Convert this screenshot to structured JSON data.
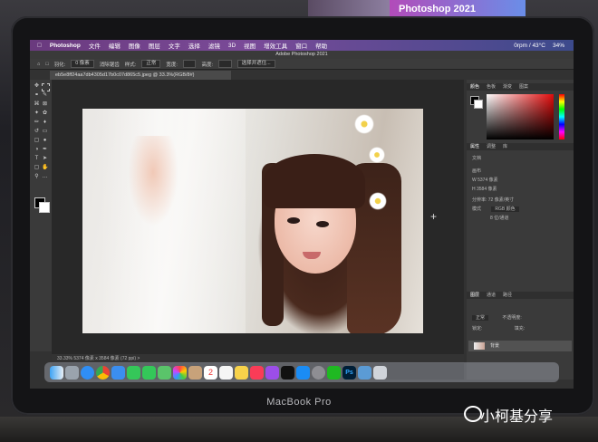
{
  "background": {
    "poster_text": "Photoshop 2021"
  },
  "laptop": {
    "model_label": "MacBook Pro"
  },
  "watermark": {
    "brand": "小柯基分享"
  },
  "menubar": {
    "items": [
      "Photoshop",
      "文件",
      "编辑",
      "图像",
      "图层",
      "文字",
      "选择",
      "滤镜",
      "3D",
      "视图",
      "增效工具",
      "窗口",
      "帮助"
    ],
    "status": [
      "0rpm / 43°C",
      "34%"
    ]
  },
  "app": {
    "title": "Adobe Photoshop 2021",
    "options": {
      "feather_label": "羽化:",
      "feather_value": "0 像素",
      "antialias": "消除锯齿",
      "style_label": "样式:",
      "style_value": "正常",
      "width_label": "宽度:",
      "height_label": "高度:",
      "select_mask": "选择并遮住..."
    },
    "document_tab": "eb5e8ff24aa7db4305d17b0c07d865c5.jpeg @ 33.3%(RGB/8#)",
    "statusbar": "33.33%   5374 像素 x 3584 像素 (72 ppi)   >"
  },
  "panels": {
    "color_tabs": [
      "颜色",
      "色板",
      "渐变",
      "图案"
    ],
    "properties_tabs": [
      "属性",
      "调整",
      "库"
    ],
    "properties": {
      "doc_label": "文档",
      "canvas_label": "画布",
      "width": "W  5374 像素",
      "height": "H  3584 像素",
      "resolution": "分辨率: 72 像素/英寸",
      "mode_label": "模式",
      "mode_value": "RGB 颜色",
      "depth_value": "8 位/通道"
    },
    "layers_tabs": [
      "图层",
      "通道",
      "路径"
    ],
    "layers": {
      "blend_mode": "正常",
      "opacity_label": "不透明度:",
      "fill_label": "填充:",
      "lock_label": "锁定:",
      "background_layer": "背景"
    }
  },
  "dock": {
    "icons": [
      "finder-icon",
      "launchpad-icon",
      "safari-icon",
      "chrome-icon",
      "mail-icon",
      "facetime-icon",
      "messages-icon",
      "maps-icon",
      "photos-icon",
      "contacts-icon",
      "calendar-icon",
      "reminders-icon",
      "notes-icon",
      "music-icon",
      "podcasts-icon",
      "tv-icon",
      "appstore-icon",
      "preferences-icon",
      "wechat-icon",
      "photoshop-icon",
      "finder2-icon",
      "trash-icon"
    ],
    "calendar_day": "2"
  },
  "colors": {
    "menubar": "#7a4a98",
    "panel": "#3a3a3a",
    "canvas": "#282828",
    "accent_red": "#e30b0b"
  }
}
